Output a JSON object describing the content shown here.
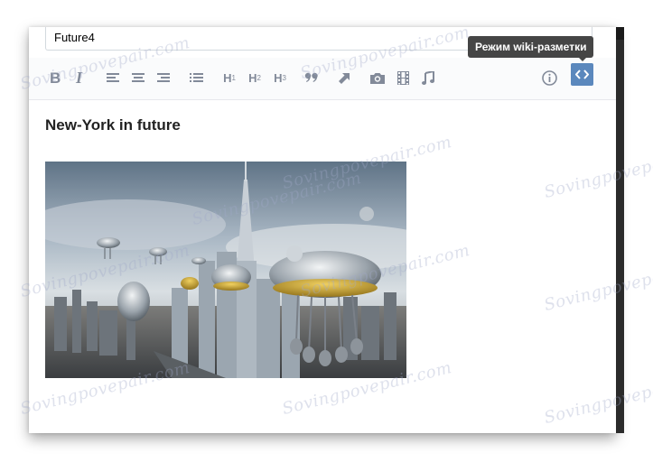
{
  "editor": {
    "title_value": "Future4",
    "heading": "New-York in future",
    "image_alt": "New York in future"
  },
  "toolbar": {
    "h1_label": "H",
    "h1_sub": "1",
    "h2_label": "H",
    "h2_sub": "2",
    "h3_label": "H",
    "h3_sub": "3",
    "quote_label": "❞"
  },
  "tooltip": {
    "text": "Режим wiki-разметки"
  },
  "watermark": {
    "text": "Sovingpovepair.com"
  },
  "colors": {
    "accent": "#5b88bd",
    "icon": "#828a99",
    "tooltip_bg": "#454545"
  }
}
